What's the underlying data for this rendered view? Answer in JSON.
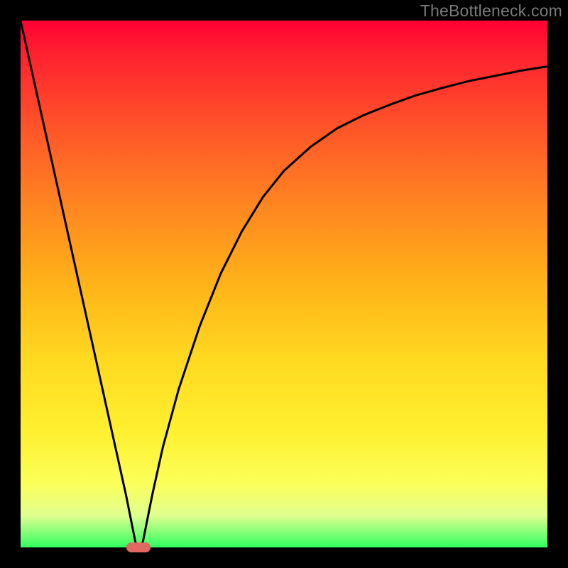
{
  "chart_data": {
    "type": "line",
    "title": "",
    "xlabel": "",
    "ylabel": "",
    "xlim": [
      0,
      100
    ],
    "ylim": [
      0,
      100
    ],
    "grid": false,
    "axis_ticks": {
      "x": [],
      "y": []
    },
    "series": [
      {
        "name": "curve",
        "points": [
          {
            "x": 0.0,
            "y": 100.0
          },
          {
            "x": 2.0,
            "y": 91.0
          },
          {
            "x": 4.0,
            "y": 82.0
          },
          {
            "x": 6.0,
            "y": 73.0
          },
          {
            "x": 8.0,
            "y": 64.0
          },
          {
            "x": 10.0,
            "y": 55.0
          },
          {
            "x": 12.0,
            "y": 46.0
          },
          {
            "x": 14.0,
            "y": 37.0
          },
          {
            "x": 16.0,
            "y": 28.0
          },
          {
            "x": 18.0,
            "y": 19.0
          },
          {
            "x": 20.0,
            "y": 10.0
          },
          {
            "x": 21.0,
            "y": 5.0
          },
          {
            "x": 21.8,
            "y": 1.0
          },
          {
            "x": 22.4,
            "y": 0.0
          },
          {
            "x": 23.2,
            "y": 1.0
          },
          {
            "x": 24.0,
            "y": 5.0
          },
          {
            "x": 25.0,
            "y": 10.0
          },
          {
            "x": 27.0,
            "y": 19.0
          },
          {
            "x": 30.0,
            "y": 30.0
          },
          {
            "x": 34.0,
            "y": 42.0
          },
          {
            "x": 38.0,
            "y": 52.0
          },
          {
            "x": 42.0,
            "y": 60.0
          },
          {
            "x": 46.0,
            "y": 66.5
          },
          {
            "x": 50.0,
            "y": 71.5
          },
          {
            "x": 55.0,
            "y": 76.0
          },
          {
            "x": 60.0,
            "y": 79.5
          },
          {
            "x": 65.0,
            "y": 82.0
          },
          {
            "x": 70.0,
            "y": 84.0
          },
          {
            "x": 75.0,
            "y": 85.8
          },
          {
            "x": 80.0,
            "y": 87.2
          },
          {
            "x": 85.0,
            "y": 88.5
          },
          {
            "x": 90.0,
            "y": 89.5
          },
          {
            "x": 95.0,
            "y": 90.5
          },
          {
            "x": 100.0,
            "y": 91.3
          }
        ]
      }
    ],
    "marker": {
      "x": 22.4,
      "y": 0.0,
      "width_pct": 4.6,
      "height_pct": 2.0,
      "color": "#e2695f"
    },
    "background_gradient": {
      "orientation": "vertical",
      "stops": [
        {
          "pos": 0.0,
          "color": "#ff0033"
        },
        {
          "pos": 0.3,
          "color": "#ff7a22"
        },
        {
          "pos": 0.6,
          "color": "#ffd820"
        },
        {
          "pos": 0.85,
          "color": "#f8ff50"
        },
        {
          "pos": 1.0,
          "color": "#30ff60"
        }
      ]
    },
    "curve_color": "#000000",
    "curve_stroke_width": 3
  },
  "watermark": "TheBottleneck.com"
}
